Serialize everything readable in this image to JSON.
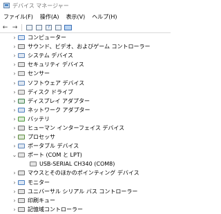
{
  "window": {
    "title": "デバイス マネージャー"
  },
  "menu": [
    "ファイル(F)",
    "操作(A)",
    "表示(V)",
    "ヘルプ(H)"
  ],
  "toolbar": {
    "back_glyph": "←",
    "forward_glyph": "→",
    "help_glyph": "?"
  },
  "tree": [
    {
      "label": "コンピューター",
      "state": "collapsed",
      "level": 1,
      "icon": "computer-icon",
      "color": "#4a7fc1"
    },
    {
      "label": "サウンド、ビデオ、およびゲーム コントローラー",
      "state": "collapsed",
      "level": 1,
      "icon": "speaker-icon",
      "color": "#6b6b6b"
    },
    {
      "label": "システム デバイス",
      "state": "collapsed",
      "level": 1,
      "icon": "system-device-icon",
      "color": "#5b84b8"
    },
    {
      "label": "セキュリティ デバイス",
      "state": "collapsed",
      "level": 1,
      "icon": "security-device-icon",
      "color": "#6d6d6d"
    },
    {
      "label": "センサー",
      "state": "collapsed",
      "level": 1,
      "icon": "sensor-icon",
      "color": "#7a7a7a"
    },
    {
      "label": "ソフトウェア デバイス",
      "state": "collapsed",
      "level": 1,
      "icon": "software-device-icon",
      "color": "#5b84b8"
    },
    {
      "label": "ディスク ドライブ",
      "state": "collapsed",
      "level": 1,
      "icon": "disk-drive-icon",
      "color": "#7a7a7a"
    },
    {
      "label": "ディスプレイ アダプター",
      "state": "collapsed",
      "level": 1,
      "icon": "display-adapter-icon",
      "color": "#3d7f4c"
    },
    {
      "label": "ネットワーク アダプター",
      "state": "collapsed",
      "level": 1,
      "icon": "network-adapter-icon",
      "color": "#4a7fc1"
    },
    {
      "label": "バッテリ",
      "state": "collapsed",
      "level": 1,
      "icon": "battery-icon",
      "color": "#4f9a3c"
    },
    {
      "label": "ヒューマン インターフェイス デバイス",
      "state": "collapsed",
      "level": 1,
      "icon": "hid-icon",
      "color": "#6d6d6d"
    },
    {
      "label": "プロセッサ",
      "state": "collapsed",
      "level": 1,
      "icon": "processor-icon",
      "color": "#5b8a3c"
    },
    {
      "label": "ポータブル デバイス",
      "state": "collapsed",
      "level": 1,
      "icon": "portable-device-icon",
      "color": "#5b84b8"
    },
    {
      "label": "ポート (COM と LPT)",
      "state": "expanded",
      "level": 1,
      "icon": "port-icon",
      "color": "#7a7a7a"
    },
    {
      "label": "USB-SERIAL CH340 (COM8)",
      "state": "none",
      "level": 2,
      "icon": "serial-port-icon",
      "color": "#7a7a7a"
    },
    {
      "label": "マウスとそのほかのポインティング デバイス",
      "state": "collapsed",
      "level": 1,
      "icon": "mouse-icon",
      "color": "#6d6d6d"
    },
    {
      "label": "モニター",
      "state": "collapsed",
      "level": 1,
      "icon": "monitor-icon",
      "color": "#4a7fc1"
    },
    {
      "label": "ユニバーサル シリアル バス コントローラー",
      "state": "collapsed",
      "level": 1,
      "icon": "usb-controller-icon",
      "color": "#6d6d6d"
    },
    {
      "label": "印刷キュー",
      "state": "collapsed",
      "level": 1,
      "icon": "print-queue-icon",
      "color": "#6d6d6d"
    },
    {
      "label": "記憶域コントローラー",
      "state": "collapsed",
      "level": 1,
      "icon": "storage-controller-icon",
      "color": "#6d6d6d"
    }
  ]
}
